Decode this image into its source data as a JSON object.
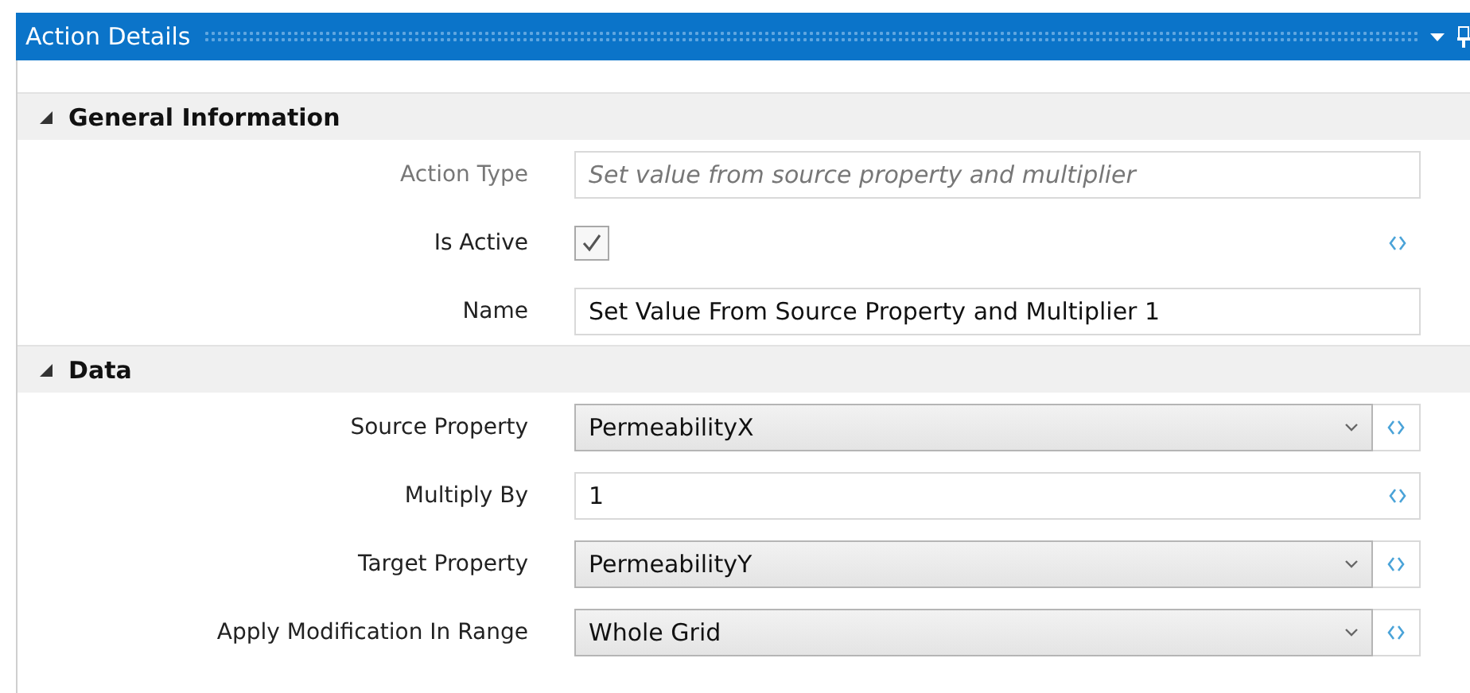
{
  "panel": {
    "title": "Action Details"
  },
  "sections": [
    {
      "title": "General Information",
      "expanded": true,
      "rows": [
        {
          "label": "Action Type",
          "kind": "readonly",
          "value": "Set value from source property and multiplier",
          "binding": false
        },
        {
          "label": "Is Active",
          "kind": "checkbox",
          "checked": true,
          "binding": true
        },
        {
          "label": "Name",
          "kind": "text",
          "value": "Set Value From Source Property and Multiplier 1",
          "binding": false
        }
      ]
    },
    {
      "title": "Data",
      "expanded": true,
      "rows": [
        {
          "label": "Source Property",
          "kind": "dropdown",
          "value": "PermeabilityX",
          "binding": true
        },
        {
          "label": "Multiply By",
          "kind": "text",
          "value": "1",
          "binding": true
        },
        {
          "label": "Target Property",
          "kind": "dropdown",
          "value": "PermeabilityY",
          "binding": true
        },
        {
          "label": "Apply Modification In Range",
          "kind": "dropdown",
          "value": "Whole Grid",
          "binding": true
        }
      ]
    }
  ]
}
